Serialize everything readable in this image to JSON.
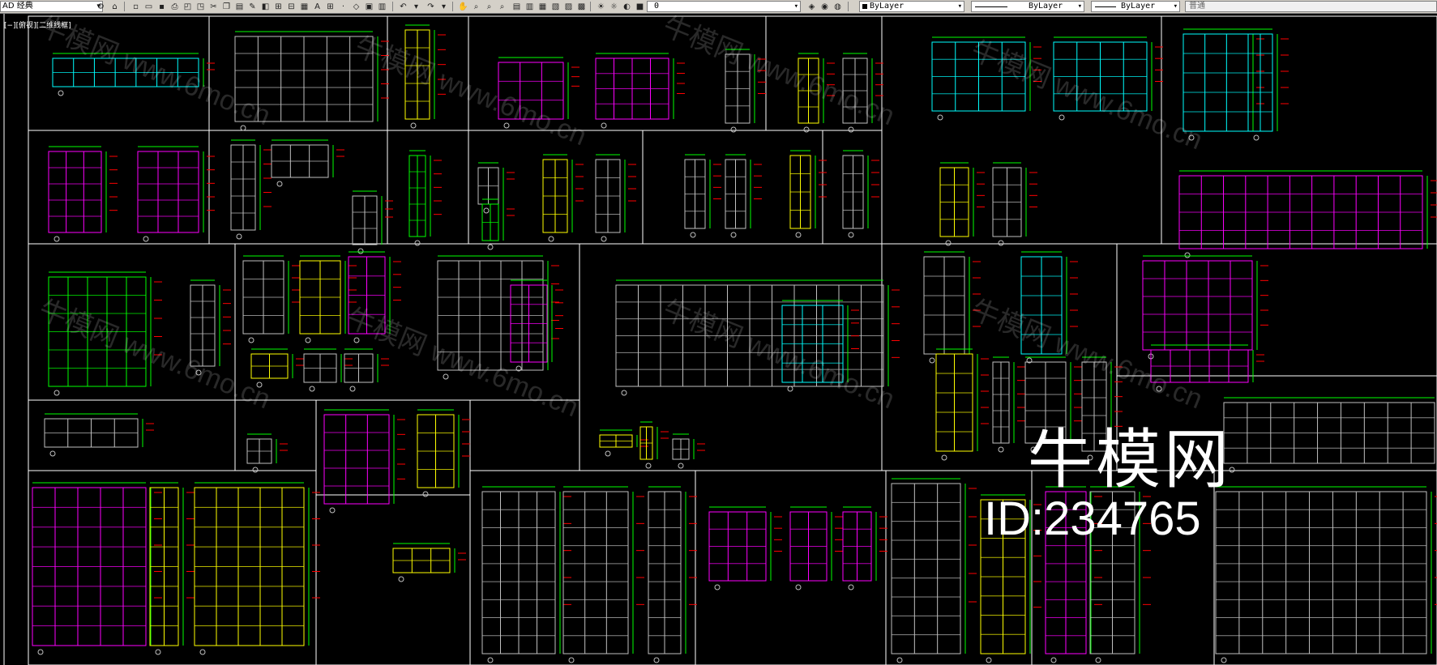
{
  "toolbar": {
    "workspace": "AD 经典",
    "layer_value": "0",
    "color_value": "ByLayer",
    "linetype_value": "ByLayer",
    "lineweight_value": "ByLayer",
    "plotstyle_value": "普通"
  },
  "viewport": {
    "label": "[−][俯视][二维线框]"
  },
  "watermark": {
    "site": "牛模网 www.6mo.cn",
    "brand": "牛模网",
    "id": "ID:234765"
  },
  "colors": {
    "frame": "#ffffff",
    "cyan": "#00ffff",
    "magenta": "#ff00ff",
    "yellow": "#ffff00",
    "green": "#00ff00",
    "red": "#ff0000",
    "blue": "#0000ff",
    "gray": "#c0c0c0"
  },
  "icons": [
    "new-icon",
    "open-icon",
    "save-icon",
    "print-icon",
    "undo-icon",
    "redo-icon",
    "pan-icon",
    "zoom-icon",
    "layer-icon",
    "properties-icon"
  ]
}
